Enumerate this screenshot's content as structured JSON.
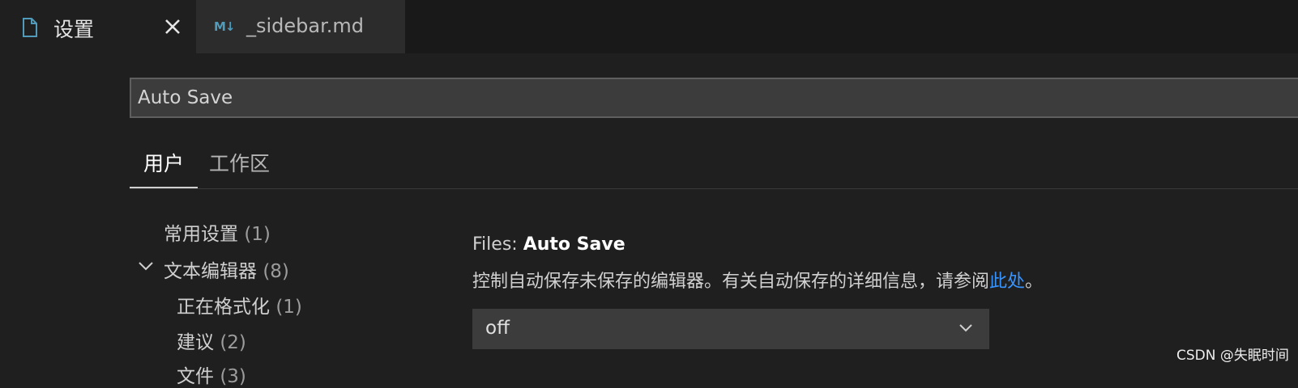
{
  "tabs": {
    "settings_label": "设置",
    "sidebar_label": "_sidebar.md",
    "md_icon": "M↓"
  },
  "search": {
    "value": "Auto Save"
  },
  "scope": {
    "user": "用户",
    "workspace": "工作区"
  },
  "toc": {
    "common_label": "常用设置",
    "common_count": "(1)",
    "text_editor_label": "文本编辑器",
    "text_editor_count": "(8)",
    "formatting_label": "正在格式化",
    "formatting_count": "(1)",
    "suggestions_label": "建议",
    "suggestions_count": "(2)",
    "files_label": "文件",
    "files_count": "(3)"
  },
  "setting": {
    "category": "Files: ",
    "name": "Auto Save",
    "description": "控制自动保存未保存的编辑器。有关自动保存的详细信息，请参阅",
    "link": "此处",
    "description_end": "。",
    "value": "off"
  },
  "watermark": "CSDN @失眠时间",
  "icons": {
    "doc": "file-icon",
    "close": "close-icon",
    "chevron": "chevron-down-icon"
  },
  "colors": {
    "link": "#3794ff",
    "md_icon": "#519aba"
  }
}
